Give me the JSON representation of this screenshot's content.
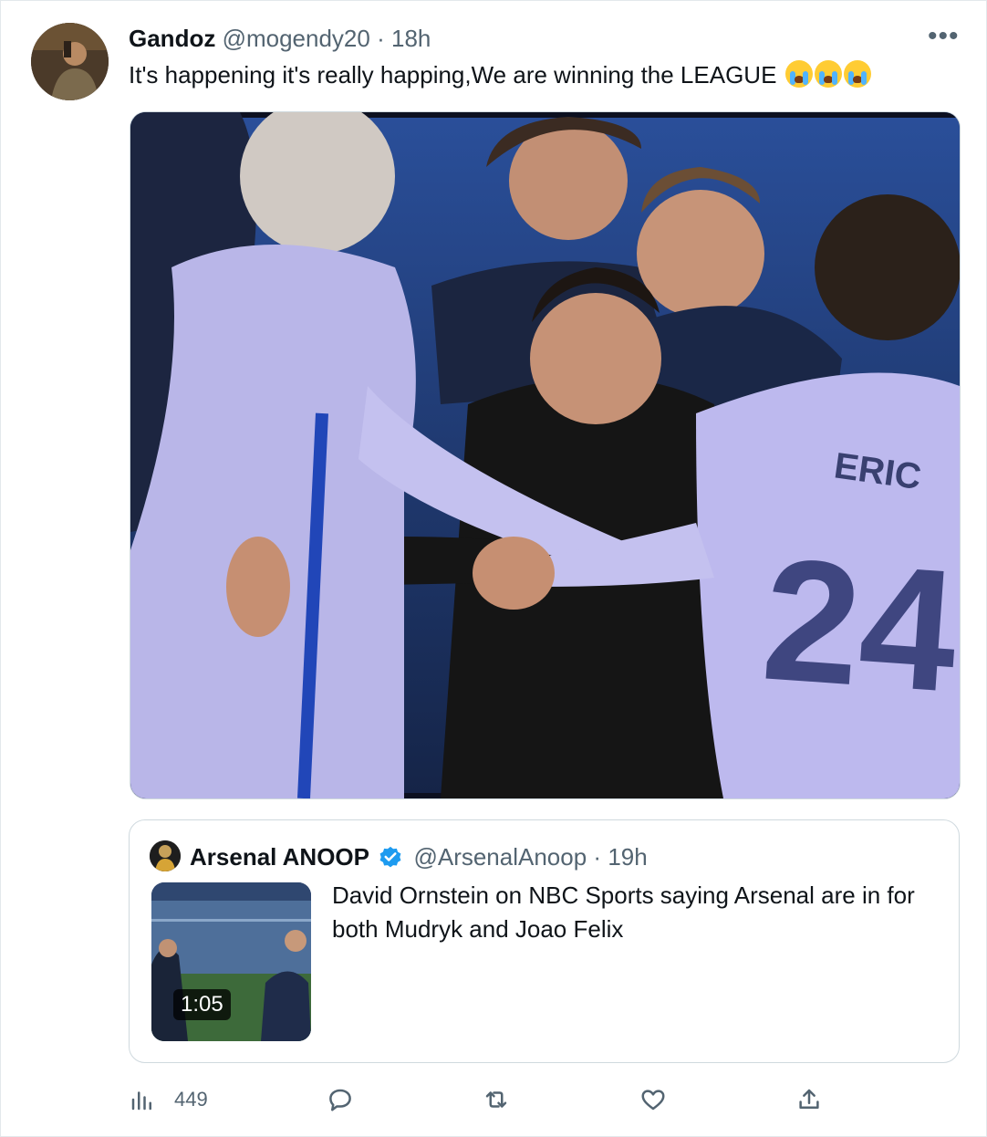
{
  "tweet": {
    "author_name": "Gandoz",
    "handle": "@mogendy20",
    "separator": "·",
    "time": "18h",
    "more_label": "•••",
    "text": "It's happening it's really happing,We are winning the LEAGUE",
    "emojis": [
      "loudly-crying-face",
      "loudly-crying-face",
      "loudly-crying-face"
    ]
  },
  "media": {
    "jersey_name": "ERIC",
    "jersey_number": "24"
  },
  "quote": {
    "author_name": "Arsenal ANOOP",
    "verified": true,
    "handle": "@ArsenalAnoop",
    "separator": "·",
    "time": "19h",
    "video_duration": "1:05",
    "text": "David Ornstein on NBC Sports saying Arsenal are in for both Mudryk and Joao Felix"
  },
  "actions": {
    "views_count": "449",
    "icons": [
      "analytics-icon",
      "reply-icon",
      "retweet-icon",
      "like-icon",
      "share-icon"
    ]
  },
  "colors": {
    "muted": "#536471",
    "verified_blue": "#1d9bf0",
    "border": "#cfd9de"
  }
}
